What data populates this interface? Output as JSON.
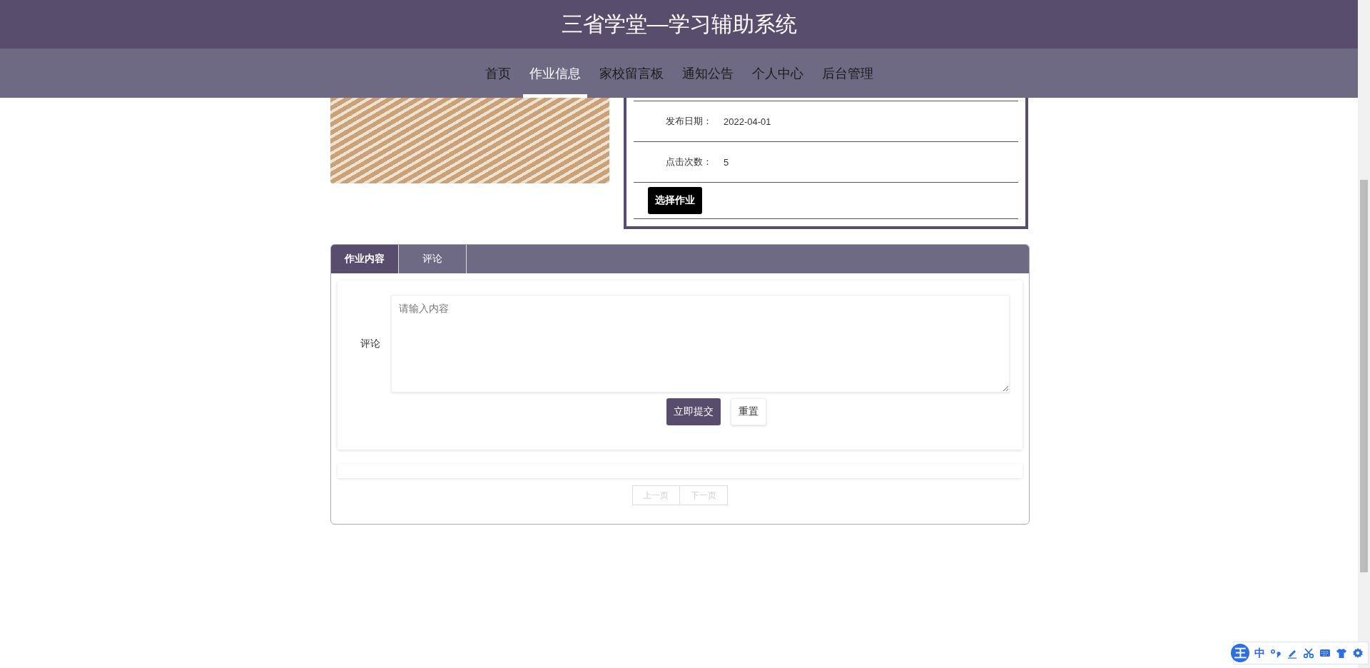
{
  "header": {
    "title": "三省学堂—学习辅助系统"
  },
  "nav": [
    {
      "label": "首页",
      "selected": false
    },
    {
      "label": "作业信息",
      "selected": true
    },
    {
      "label": "家校留言板",
      "selected": false
    },
    {
      "label": "通知公告",
      "selected": false
    },
    {
      "label": "个人中心",
      "selected": false
    },
    {
      "label": "后台管理",
      "selected": false
    }
  ],
  "details": [
    {
      "label": "发布日期：",
      "value": "2022-04-01"
    },
    {
      "label": "点击次数：",
      "value": "5"
    }
  ],
  "select_button": "选择作业",
  "tabs": [
    {
      "label": "作业内容",
      "selected": true
    },
    {
      "label": "评论",
      "selected": false
    }
  ],
  "comment_form": {
    "label": "评论",
    "placeholder": "请输入内容",
    "submit": "立即提交",
    "reset": "重置"
  },
  "pagination": [
    {
      "label": "上一页",
      "disabled": true
    },
    {
      "label": "下一页",
      "disabled": true
    }
  ],
  "ime_toolbar": {
    "logo": "王",
    "mode": "中"
  }
}
